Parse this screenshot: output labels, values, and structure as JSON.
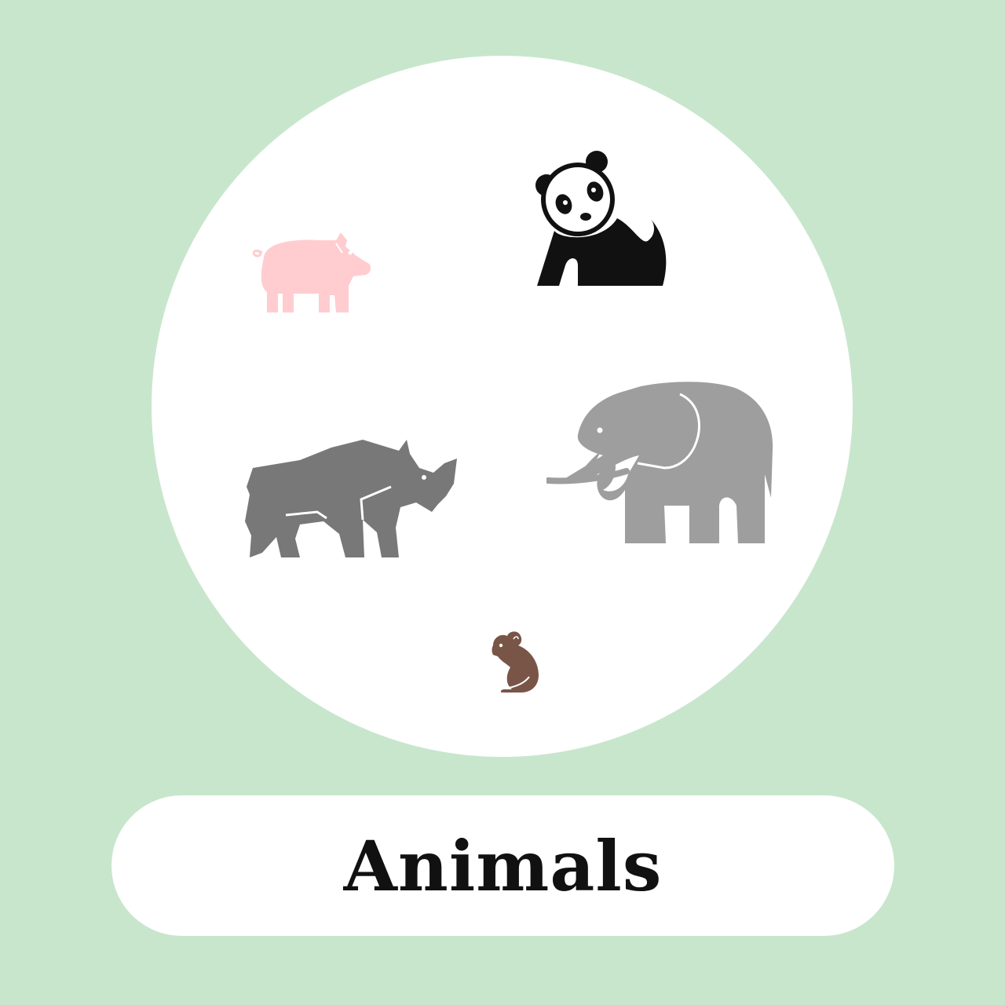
{
  "colors": {
    "background": "#c8e6cc",
    "circle": "#ffffff",
    "pig": "#ffcdd0",
    "panda": "#111111",
    "rhino": "#787878",
    "elephant": "#9e9e9e",
    "mouse": "#795548",
    "label_text": "#111111"
  },
  "animals": [
    {
      "name": "pig",
      "icon": "pig-icon"
    },
    {
      "name": "panda",
      "icon": "panda-icon"
    },
    {
      "name": "rhino",
      "icon": "rhino-icon"
    },
    {
      "name": "elephant",
      "icon": "elephant-icon"
    },
    {
      "name": "mouse",
      "icon": "mouse-icon"
    }
  ],
  "label": {
    "text": "Animals"
  }
}
